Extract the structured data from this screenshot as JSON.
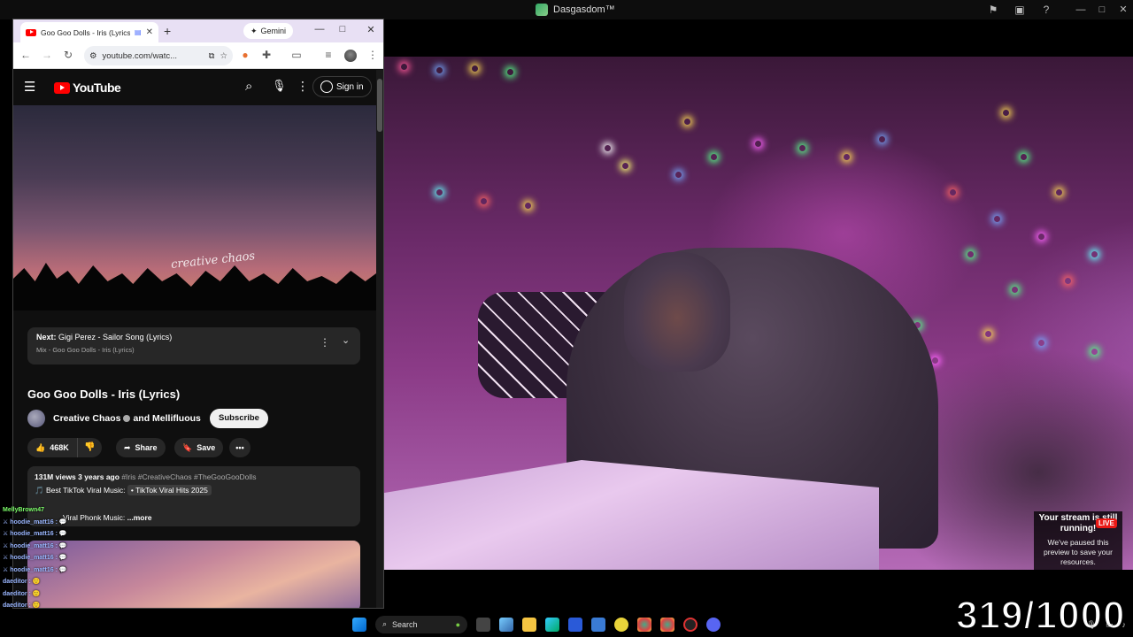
{
  "app": {
    "title": "Dasgasdom™"
  },
  "browser": {
    "tab_title": "Goo Goo Dolls - Iris (Lyrics)",
    "gemini_label": "Gemini",
    "url": "youtube.com/watc..."
  },
  "youtube": {
    "logo_text": "YouTube",
    "signin_label": "Sign in",
    "video_watermark": "creative chaos",
    "next_prefix": "Next:",
    "next_title": "Gigi Perez - Sailor Song (Lyrics)",
    "next_mix": "Mix - Goo Goo Dolls - Iris (Lyrics)",
    "video_title": "Goo Goo Dolls - Iris (Lyrics)",
    "channel_text": "Creative Chaos",
    "channel_suffix": "and Mellifluous",
    "subscribe_label": "Subscribe",
    "likes": "468K",
    "share_label": "Share",
    "save_label": "Save",
    "views": "131M views",
    "age": "3 years ago",
    "hashtags": "#Iris #CreativeChaos #TheGooGooDolls",
    "desc_line2_prefix": "Best TikTok Viral Music:",
    "desc_line2_chip": "• TikTok Viral Hits 2025",
    "desc_line3": "Viral Phonk Music:",
    "more_label": "...more"
  },
  "stream": {
    "paused_title": "Your stream is still running!",
    "live_badge": "LIVE",
    "paused_msg": "We've paused this preview to save your resources.",
    "counter": "319/1000"
  },
  "chat": [
    {
      "user": "MellyBrown47",
      "msg": ""
    },
    {
      "user": "hoodie_matt16 :",
      "msg": "💬"
    },
    {
      "user": "hoodie_matt16 :",
      "msg": "💬"
    },
    {
      "user": "hoodie_matt16 :",
      "msg": "💬"
    },
    {
      "user": "hoodie_matt16 :",
      "msg": "💬"
    },
    {
      "user": "hoodie_matt16 :",
      "msg": "💬"
    },
    {
      "user": "daeditor :",
      "msg": "🙂"
    },
    {
      "user": "daeditor :",
      "msg": "🙂"
    },
    {
      "user": "daeditor :",
      "msg": "🙂"
    }
  ],
  "taskbar": {
    "search_label": "Search"
  }
}
